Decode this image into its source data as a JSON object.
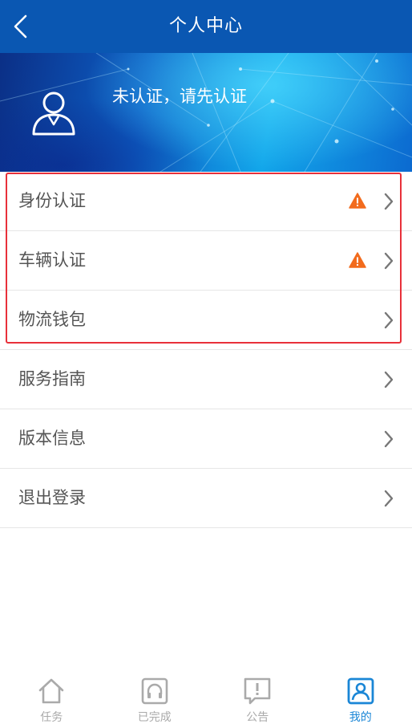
{
  "header": {
    "title": "个人中心",
    "back_icon": "back-arrow-icon"
  },
  "profile": {
    "status_text": "未认证，请先认证",
    "avatar_icon": "user-avatar-icon"
  },
  "menu": [
    {
      "label": "身份认证",
      "warning": true
    },
    {
      "label": "车辆认证",
      "warning": true
    },
    {
      "label": "物流钱包",
      "warning": false
    },
    {
      "label": "服务指南",
      "warning": false
    },
    {
      "label": "版本信息",
      "warning": false
    },
    {
      "label": "退出登录",
      "warning": false
    }
  ],
  "tabbar": {
    "active": 3,
    "items": [
      {
        "label": "任务",
        "icon": "home-icon"
      },
      {
        "label": "已完成",
        "icon": "headset-icon"
      },
      {
        "label": "公告",
        "icon": "announcement-icon"
      },
      {
        "label": "我的",
        "icon": "profile-icon"
      }
    ]
  },
  "colors": {
    "header_bg": "#0a57b2",
    "warning": "#f26b1d",
    "highlight_border": "#e8303a",
    "tab_active": "#1a86d6",
    "tab_inactive": "#aaaaaa"
  }
}
